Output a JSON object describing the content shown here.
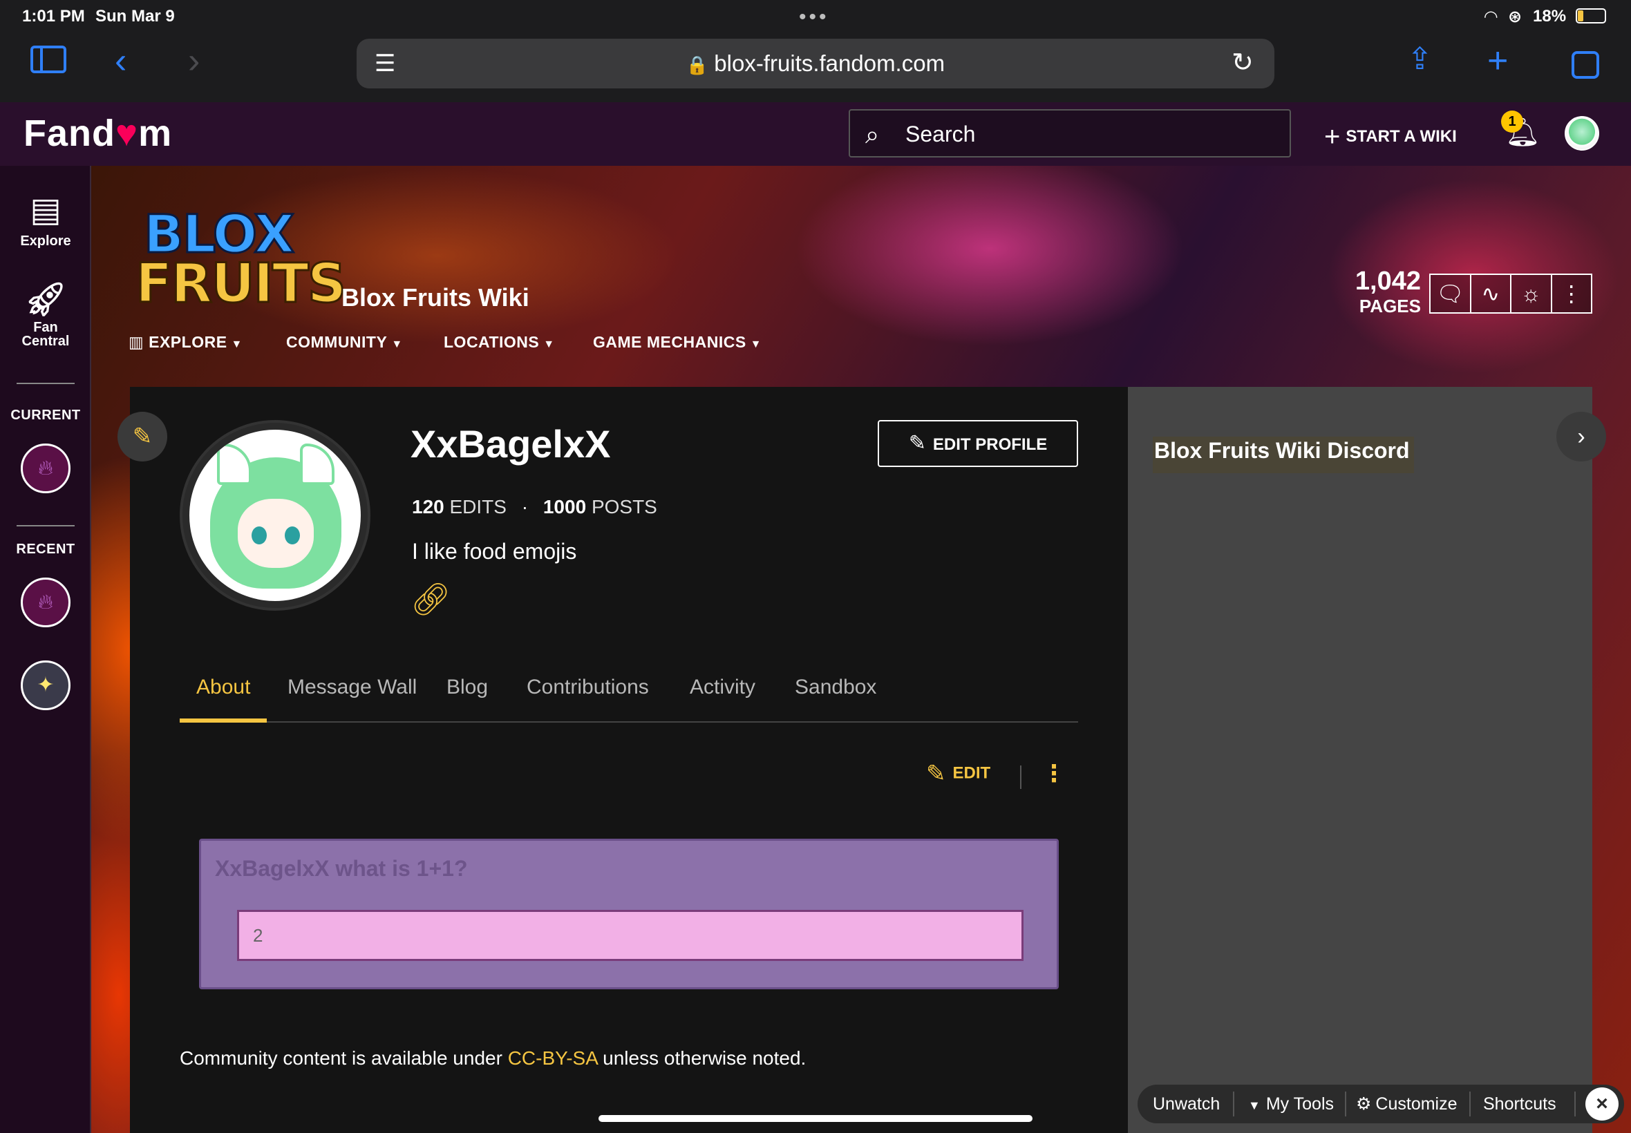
{
  "status_bar": {
    "time": "1:01 PM",
    "date": "Sun Mar 9",
    "battery": "18%"
  },
  "browser": {
    "url": "blox-fruits.fandom.com",
    "icons": [
      "sidebar-icon",
      "back-icon",
      "forward-icon",
      "reader-icon",
      "reload-icon",
      "share-icon",
      "new-tab-icon",
      "tabs-icon"
    ]
  },
  "fandom_header": {
    "logo_pre": "Fand",
    "logo_heart": "♥",
    "logo_post": "m",
    "search_placeholder": "Search",
    "start_wiki": "START A WIKI",
    "notification_count": "1"
  },
  "left_rail": {
    "explore": "Explore",
    "fan_central_1": "Fan",
    "fan_central_2": "Central",
    "current": "CURRENT",
    "recent": "RECENT"
  },
  "community": {
    "logo_line1": "BLOX",
    "logo_line2": "FRUITS",
    "name": "Blox Fruits Wiki",
    "nav": [
      "EXPLORE",
      "COMMUNITY",
      "LOCATIONS",
      "GAME MECHANICS"
    ],
    "pages_count": "1,042",
    "pages_label": "PAGES"
  },
  "profile": {
    "username": "XxBagelxX",
    "edit_profile": "EDIT PROFILE",
    "edits_count": "120",
    "edits_label": "EDITS",
    "posts_count": "1000",
    "posts_label": "POSTS",
    "bio": "I like food emojis"
  },
  "tabs": [
    "About",
    "Message Wall",
    "Blog",
    "Contributions",
    "Activity",
    "Sandbox"
  ],
  "active_tab": "About",
  "content": {
    "edit_label": "EDIT",
    "question": "XxBagelxX what is 1+1?",
    "answer": "2",
    "license_pre": "Community content is available under ",
    "license_link": "CC-BY-SA",
    "license_post": " unless otherwise noted."
  },
  "right_rail": {
    "discord_title": "Blox Fruits Wiki Discord"
  },
  "bottom_toolbar": {
    "unwatch": "Unwatch",
    "my_tools": "My Tools",
    "customize": "Customize",
    "shortcuts": "Shortcuts"
  },
  "colors": {
    "accent": "#f5c542",
    "header_bg": "#2a0f2c",
    "quiz_bg": "#8c71aa",
    "answer_bg": "#f2b0e6"
  }
}
